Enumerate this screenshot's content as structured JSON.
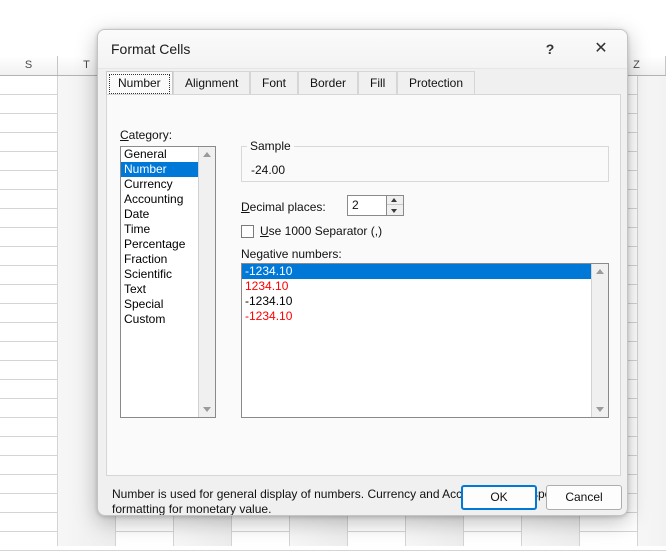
{
  "spreadsheet": {
    "column_headers": [
      "S",
      "T",
      "Z"
    ]
  },
  "dialog": {
    "title": "Format Cells",
    "help_icon": "question-mark-icon",
    "close_icon": "close-icon",
    "tabs": [
      {
        "label": "Number",
        "active": true
      },
      {
        "label": "Alignment",
        "active": false
      },
      {
        "label": "Font",
        "active": false
      },
      {
        "label": "Border",
        "active": false
      },
      {
        "label": "Fill",
        "active": false
      },
      {
        "label": "Protection",
        "active": false
      }
    ],
    "category": {
      "label": "Category:",
      "accelerator": "C",
      "items": [
        "General",
        "Number",
        "Currency",
        "Accounting",
        "Date",
        "Time",
        "Percentage",
        "Fraction",
        "Scientific",
        "Text",
        "Special",
        "Custom"
      ],
      "selected": "Number",
      "selected_index": 1
    },
    "sample": {
      "legend": "Sample",
      "value": "-24.00"
    },
    "decimal_places": {
      "label": "Decimal places:",
      "accelerator": "D",
      "value": "2"
    },
    "thousands_separator": {
      "label": "Use 1000 Separator (,)",
      "accelerator": "U",
      "checked": false
    },
    "negative_numbers": {
      "label": "Negative numbers:",
      "selected_index": 0,
      "items": [
        {
          "text": "-1234.10",
          "color": "#ffffff",
          "selected": true
        },
        {
          "text": "1234.10",
          "color": "#ff0000",
          "selected": false
        },
        {
          "text": "-1234.10",
          "color": "#000000",
          "selected": false
        },
        {
          "text": "-1234.10",
          "color": "#ff0000",
          "selected": false
        }
      ]
    },
    "description": "Number is used for general display of numbers.  Currency and Accounting offer specialized formatting for monetary value.",
    "buttons": {
      "ok": "OK",
      "cancel": "Cancel"
    },
    "colors": {
      "selection_blue": "#0078d7",
      "negative_red": "#ff0000",
      "focus_border": "#0078d7"
    }
  }
}
